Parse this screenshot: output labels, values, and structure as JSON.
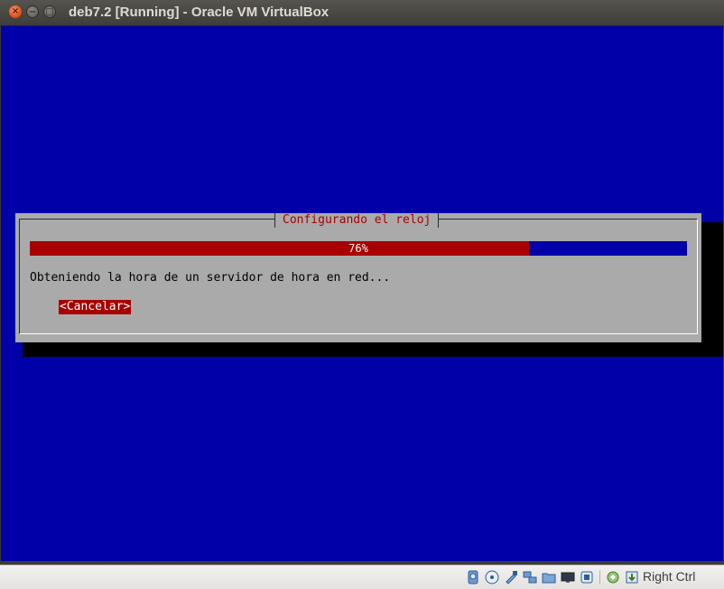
{
  "window": {
    "title": "deb7.2 [Running] - Oracle VM VirtualBox",
    "controls": {
      "close": "×",
      "minimize": "−",
      "maximize": "□"
    }
  },
  "installer": {
    "dialog_title": "Configurando el reloj",
    "progress_percent": 76,
    "progress_label": "76%",
    "message": "Obteniendo la hora de un servidor de hora en red...",
    "cancel_label": "<Cancelar>",
    "colors": {
      "screen_bg": "#0000a8",
      "dialog_bg": "#aaaaaa",
      "accent": "#a80000"
    }
  },
  "statusbar": {
    "icons": [
      "hard-disk-icon",
      "optical-drive-icon",
      "usb-icon",
      "network-icon",
      "shared-folders-icon",
      "display-icon",
      "video-capture-icon",
      "mouse-integration-icon",
      "keyboard-capture-icon"
    ],
    "host_key": "Right Ctrl"
  }
}
